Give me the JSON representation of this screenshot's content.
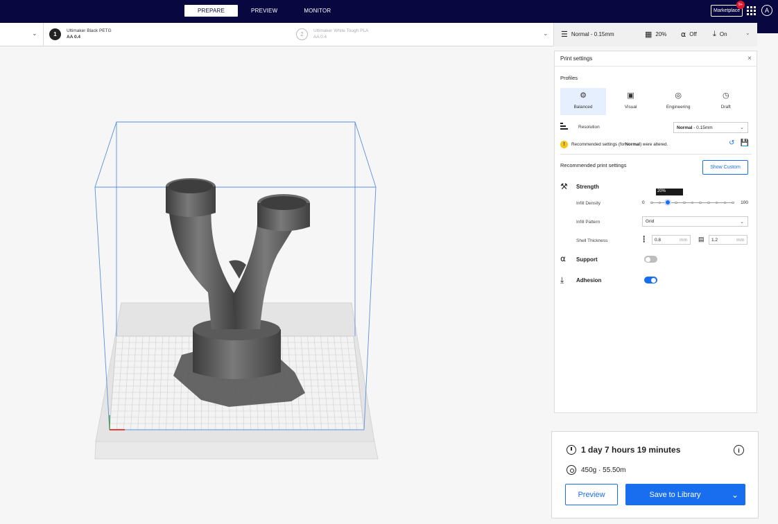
{
  "stage_tabs": [
    {
      "label": "PREPARE",
      "active": true
    },
    {
      "label": "PREVIEW",
      "active": false
    },
    {
      "label": "MONITOR",
      "active": false
    }
  ],
  "topbar": {
    "marketplace_label": "Marketplace",
    "notification_badge": "9+",
    "account_initial": "A"
  },
  "extruders": [
    {
      "number": "1",
      "material": "Ultimaker Black PETG",
      "core": "AA 0.4"
    },
    {
      "number": "2",
      "material": "Ultimaker White Tough PLA",
      "core": "AA 0.4"
    }
  ],
  "settings_bar": {
    "profile": "Normal - 0.15mm",
    "infill": "20%",
    "support": "Off",
    "adhesion": "On"
  },
  "print_settings": {
    "title": "Print settings",
    "profiles_label": "Profiles",
    "profiles": [
      {
        "label": "Balanced",
        "icon": "gear-icon",
        "active": true
      },
      {
        "label": "Visual",
        "icon": "image-icon",
        "active": false
      },
      {
        "label": "Engineering",
        "icon": "cog-icon",
        "active": false
      },
      {
        "label": "Draft",
        "icon": "gauge-icon",
        "active": false
      }
    ],
    "resolution_label": "Resolution",
    "resolution_value_bold": "Normal",
    "resolution_value_rest": " - 0.15mm",
    "warning_prefix": "Recommended settings (for ",
    "warning_bold": "Normal",
    "warning_suffix": ") were altered.",
    "recommended_label": "Recommended print settings",
    "show_custom": "Show Custom",
    "strength_label": "Strength",
    "infill_density_label": "Infill Density",
    "infill_tooltip": "20%",
    "infill_min": "0",
    "infill_max": "100",
    "infill_value": 20,
    "infill_pattern_label": "Infill Pattern",
    "infill_pattern_value": "Grid",
    "shell_thickness_label": "Shell Thickness",
    "shell_wall": "0.8",
    "shell_top": "1.2",
    "unit": "mm",
    "support_label": "Support",
    "support_on": false,
    "adhesion_label": "Adhesion",
    "adhesion_on": true
  },
  "job": {
    "time": "1 day 7 hours 19 minutes",
    "material": "450g · 55.50m",
    "preview_button": "Preview",
    "save_button": "Save to Library"
  },
  "colors": {
    "topbar": "#08073f",
    "accent": "#196ef0",
    "warning": "#f2c71c",
    "badge": "#e0192f"
  }
}
